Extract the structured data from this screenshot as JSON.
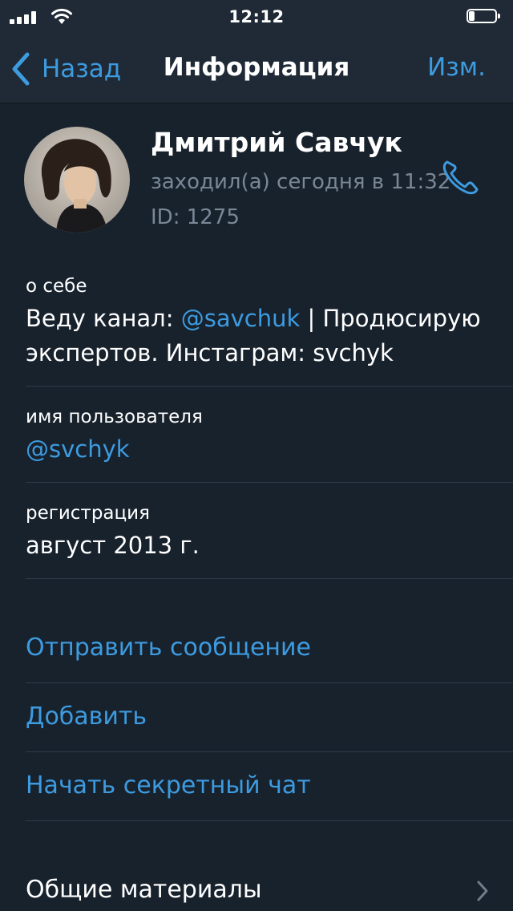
{
  "status_bar": {
    "time": "12:12",
    "battery_level": 0.22
  },
  "nav": {
    "back_label": "Назад",
    "title": "Информация",
    "edit_label": "Изм."
  },
  "profile": {
    "name": "Дмитрий Савчук",
    "last_seen": "заходил(а) сегодня в 11:32",
    "id_text": "ID: 1275"
  },
  "bio": {
    "label": "о себе",
    "line1_prefix": "Веду канал: ",
    "line1_link": "@savchuk",
    "line1_suffix": " | Продюсирую",
    "line2": "экспертов. Инстаграм: svchyk"
  },
  "username": {
    "label": "имя пользователя",
    "value": "@svchyk"
  },
  "registration": {
    "label": "регистрация",
    "value": "август 2013 г."
  },
  "actions": {
    "send_message": "Отправить сообщение",
    "add": "Добавить",
    "secret_chat": "Начать секретный чат"
  },
  "shared": {
    "label": "Общие материалы"
  },
  "icons": {
    "back": "chevron-left-icon",
    "call": "phone-icon",
    "shared": "chevron-right-icon"
  },
  "colors": {
    "background": "#18222d",
    "bar": "#1f2a36",
    "accent": "#3d9be0",
    "secondary_text": "#7a8896",
    "separator": "#2e3a47"
  }
}
